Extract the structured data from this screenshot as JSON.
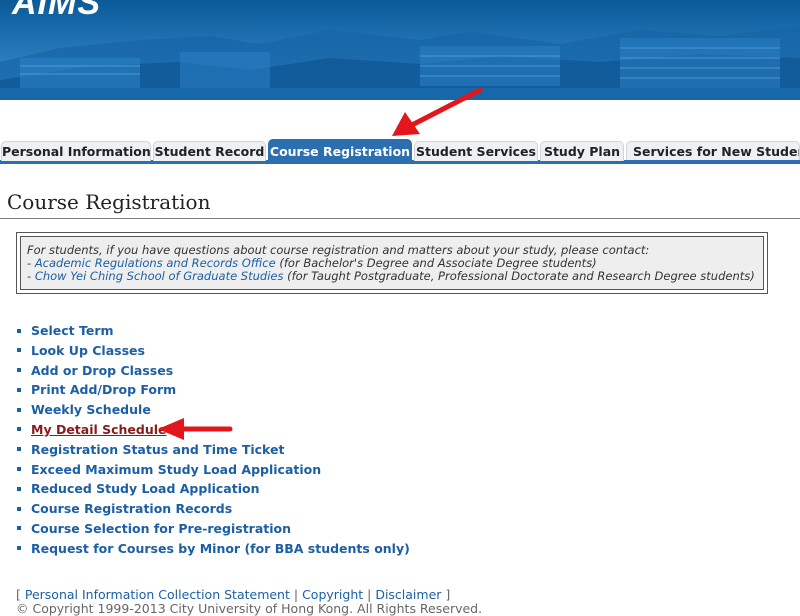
{
  "header": {
    "logo_text": "AIMS"
  },
  "tabs": [
    {
      "label": "Personal Information",
      "active": false
    },
    {
      "label": "Student Record",
      "active": false
    },
    {
      "label": "Course Registration",
      "active": true
    },
    {
      "label": "Student Services",
      "active": false
    },
    {
      "label": "Study Plan",
      "active": false
    },
    {
      "label": "Services for New Students",
      "active": false
    }
  ],
  "page": {
    "title": "Course Registration"
  },
  "info": {
    "intro": "For students, if you have questions about course registration and matters about your study, please contact:",
    "line1_prefix": "- ",
    "line1_link": "Academic Regulations and Records Office",
    "line1_suffix": " (for Bachelor's Degree and Associate Degree students)",
    "line2_prefix": "- ",
    "line2_link": "Chow Yei Ching School of Graduate Studies",
    "line2_suffix": " (for Taught Postgraduate, Professional Doctorate and Research Degree students)"
  },
  "menu": [
    {
      "label": "Select Term"
    },
    {
      "label": "Look Up Classes"
    },
    {
      "label": "Add or Drop Classes"
    },
    {
      "label": "Print Add/Drop Form"
    },
    {
      "label": "Weekly Schedule"
    },
    {
      "label": "My Detail Schedule",
      "visited": true
    },
    {
      "label": "Registration Status and Time Ticket"
    },
    {
      "label": "Exceed Maximum Study Load Application"
    },
    {
      "label": "Reduced Study Load Application"
    },
    {
      "label": "Course Registration Records"
    },
    {
      "label": "Course Selection for Pre-registration"
    },
    {
      "label": "Request for Courses by Minor (for BBA students only)"
    }
  ],
  "footer": {
    "open": "[ ",
    "link1": "Personal Information Collection Statement",
    "sep": " | ",
    "link2": "Copyright",
    "link3": "Disclaimer",
    "close": " ]",
    "copyright": "© Copyright 1999-2013 City University of Hong Kong. All Rights Reserved."
  },
  "colors": {
    "tab_active": "#2b6fb0",
    "link": "#1c5fa5",
    "visited": "#8b1a1a",
    "annotation_arrow": "#e3161b"
  }
}
